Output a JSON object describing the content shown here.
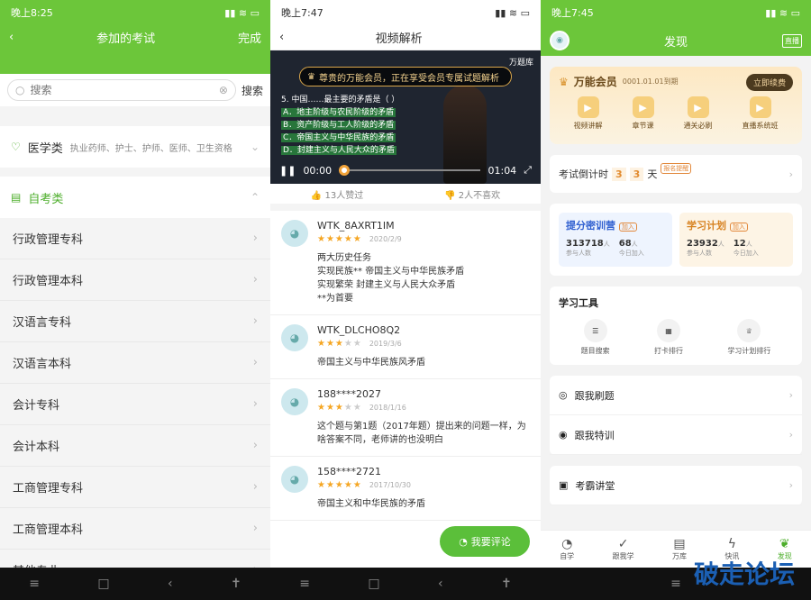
{
  "panel1": {
    "status_time": "晚上8:25",
    "title": "参加的考试",
    "done": "完成",
    "search_placeholder": "搜索",
    "search_btn": "搜索",
    "medical": {
      "name": "医学类",
      "sub": "执业药师、护士、护师、医师、卫生资格"
    },
    "self_exam": {
      "name": "自考类"
    },
    "items": [
      "行政管理专科",
      "行政管理本科",
      "汉语言专科",
      "汉语言本科",
      "会计专科",
      "会计本科",
      "工商管理专科",
      "工商管理本科",
      "其他专业"
    ]
  },
  "panel2": {
    "status_time": "晚上7:47",
    "title": "视频解析",
    "vip_banner": "尊贵的万能会员，正在享受会员专属试题解析",
    "brand": "万题库",
    "question_lines": [
      "5. 中国……最主要的矛盾是（ ）",
      "A．地主阶级与农民阶级的矛盾",
      "B．资产阶级与工人阶级的矛盾",
      "C．帝国主义与中华民族的矛盾",
      "D．封建主义与人民大众的矛盾"
    ],
    "time_start": "00:00",
    "time_end": "01:04",
    "likes": "13人赞过",
    "dislikes": "2人不喜欢",
    "comments": [
      {
        "user": "WTK_8AXRT1IM",
        "stars": 5,
        "date": "2020/2/9",
        "text": "两大历史任务\n实现民族** 帝国主义与中华民族矛盾\n实现繁荣 封建主义与人民大众矛盾\n**为首要"
      },
      {
        "user": "WTK_DLCHO8Q2",
        "stars": 3,
        "date": "2019/3/6",
        "text": "帝国主义与中华民族风矛盾"
      },
      {
        "user": "188****2027",
        "stars": 3,
        "date": "2018/1/16",
        "text": "这个题与第1题（2017年题）提出来的问题一样，为啥答案不同，老师讲的也没明白"
      },
      {
        "user": "158****2721",
        "stars": 5,
        "date": "2017/10/30",
        "text": "帝国主义和中华民族的矛盾"
      }
    ],
    "comment_btn": "我要评论"
  },
  "panel3": {
    "status_time": "晚上7:45",
    "title": "发现",
    "live": "直播",
    "vip_title": "万能会员",
    "vip_expire": "0001.01.01到期",
    "renew": "立即续费",
    "vip_icons": [
      "视频讲解",
      "章节课",
      "通关必刷",
      "直播系统班"
    ],
    "countdown_label": "考试倒计时",
    "countdown_digits": [
      "3",
      "3"
    ],
    "countdown_unit": "天",
    "countdown_tag": "报名提醒",
    "camp": {
      "title": "提分密训营",
      "tag": "加入",
      "n1": "313718",
      "u1": "人",
      "l1": "参与人数",
      "n2": "68",
      "u2": "人",
      "l2": "今日加入"
    },
    "plan": {
      "title": "学习计划",
      "tag": "加入",
      "n1": "23932",
      "u1": "人",
      "l1": "参与人数",
      "n2": "12",
      "u2": "人",
      "l2": "今日加入"
    },
    "tools_title": "学习工具",
    "tools": [
      "题目搜索",
      "打卡排行",
      "学习计划排行"
    ],
    "links": [
      "跟我刷题",
      "跟我特训",
      "考霸讲堂"
    ],
    "tabs": [
      "自学",
      "跟我学",
      "万库",
      "快讯",
      "发现"
    ]
  },
  "watermark": "破走论坛"
}
